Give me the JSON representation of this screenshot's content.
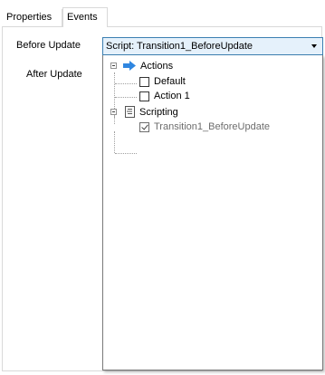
{
  "tabs": [
    {
      "label": "Properties",
      "active": false
    },
    {
      "label": "Events",
      "active": true
    }
  ],
  "fields": {
    "before_update_label": "Before Update",
    "after_update_label": "After Update"
  },
  "combo": {
    "value": "Script: Transition1_BeforeUpdate"
  },
  "tree": {
    "actions": {
      "label": "Actions",
      "items": [
        {
          "label": "Default",
          "checked": false
        },
        {
          "label": "Action 1",
          "checked": false
        }
      ]
    },
    "scripting": {
      "label": "Scripting",
      "items": [
        {
          "label": "Transition1_BeforeUpdate",
          "checked": true
        }
      ]
    }
  },
  "colors": {
    "combo_border": "#3c7fb1",
    "combo_bg": "#e5f1fb",
    "actions_icon": "#2f86e0"
  }
}
